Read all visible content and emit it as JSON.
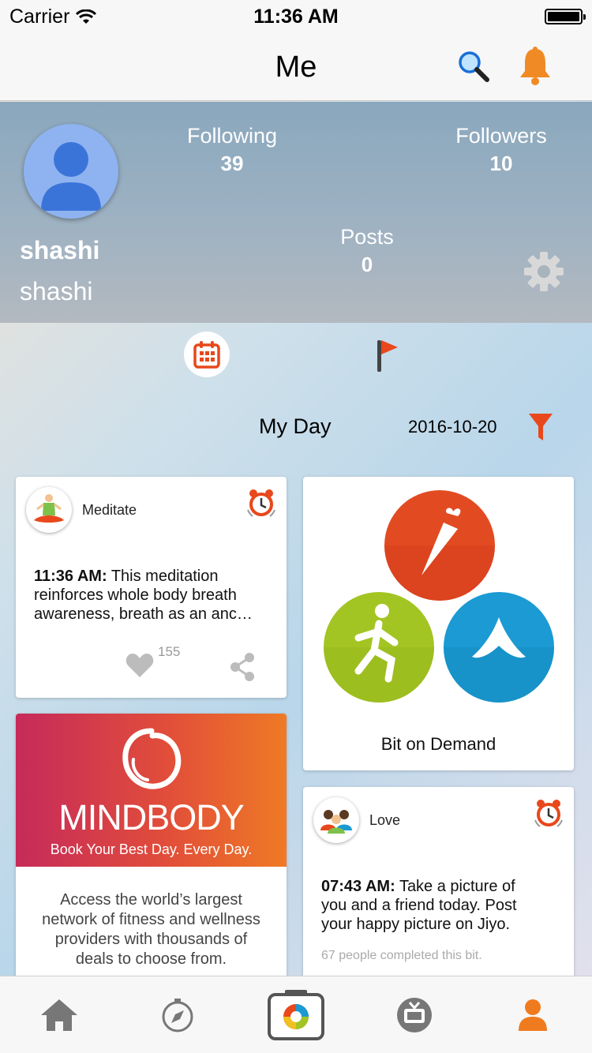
{
  "status": {
    "carrier": "Carrier",
    "time": "11:36 AM"
  },
  "nav": {
    "title": "Me"
  },
  "profile": {
    "username": "shashi",
    "handle": "shashi",
    "following_label": "Following",
    "following": "39",
    "followers_label": "Followers",
    "followers": "10",
    "posts_label": "Posts",
    "posts": "0"
  },
  "filter": {
    "title": "My Day",
    "date": "2016-10-20"
  },
  "cards": {
    "meditate": {
      "title": "Meditate",
      "time": "11:36 AM:",
      "text_line1": "This meditation",
      "text_line2": "reinforces whole body breath",
      "text_line3": "awareness, breath as an anc…",
      "likes": "155"
    },
    "bit_on_demand": {
      "label": "Bit on Demand"
    },
    "mindbody": {
      "brand": "MINDBODY",
      "tagline": "Book Your Best Day. Every Day.",
      "desc_line1": "Access the world’s largest",
      "desc_line2": "network of fitness and wellness",
      "desc_line3": "providers with thousands of",
      "desc_line4": "deals to choose from."
    },
    "love": {
      "title": "Love",
      "time": "07:43 AM:",
      "text_line1": "Take a picture of",
      "text_line2": "you and a friend today. Post",
      "text_line3": "your happy picture on Jiyo.",
      "completed": "67 people completed this bit."
    }
  },
  "colors": {
    "accent": "#f07b1e",
    "filter": "#e8481c",
    "calendar": "#e8481c",
    "love_orange": "#f07b1e"
  },
  "icons": [
    "search-icon",
    "bell-icon",
    "gear-icon",
    "calendar-icon",
    "flag-icon",
    "filter-icon",
    "alarm-icon",
    "heart-icon",
    "share-icon",
    "home-icon",
    "compass-icon",
    "camera-icon",
    "tv-icon",
    "profile-icon"
  ]
}
